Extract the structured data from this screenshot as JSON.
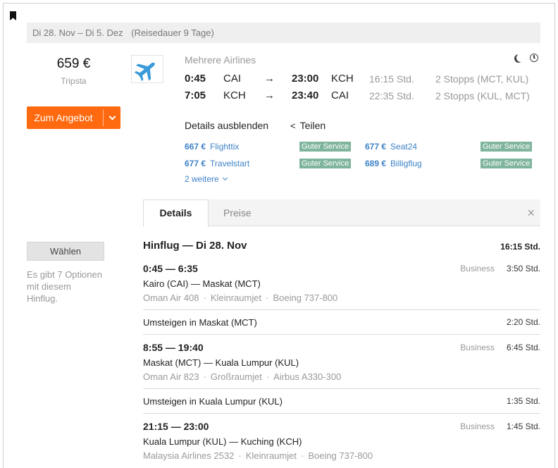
{
  "trip": {
    "dates": "Di 28. Nov – Di 5. Dez",
    "duration": "(Reisedauer 9 Tage)"
  },
  "price": {
    "amount": "659 €",
    "provider": "Tripsta",
    "deal_label": "Zum Angebot"
  },
  "airline": {
    "name": "Mehrere Airlines",
    "logo_icon": "airplane-icon",
    "logo_color": "#3a9ad9"
  },
  "legs": [
    {
      "dep": "0:45",
      "from": "CAI",
      "arrow": "→",
      "arr": "23:00",
      "to": "KCH",
      "duration": "16:15 Std.",
      "stops": "2 Stopps (MCT, KUL)"
    },
    {
      "dep": "7:05",
      "from": "KCH",
      "arrow": "→",
      "arr": "23:40",
      "to": "CAI",
      "duration": "22:35 Std.",
      "stops": "2 Stopps (KUL, MCT)"
    }
  ],
  "actions": {
    "hide_details": "Details ausblenden",
    "share": "Teilen",
    "more": "2 weitere"
  },
  "offers": [
    {
      "price": "667 €",
      "name": "Flighttix",
      "badge": "Guter Service"
    },
    {
      "price": "677 €",
      "name": "Seat24",
      "badge": "Guter Service"
    },
    {
      "price": "677 €",
      "name": "Travelstart",
      "badge": "Guter Service"
    },
    {
      "price": "689 €",
      "name": "Billigflug",
      "badge": "Guter Service"
    }
  ],
  "tabs": {
    "details": "Details",
    "prices": "Preise",
    "close": "×"
  },
  "choose": {
    "button": "Wählen",
    "note": "Es gibt 7 Optionen mit diesem Hinflug."
  },
  "outbound": {
    "title": "Hinflug — Di 28. Nov",
    "total": "16:15 Std.",
    "segments": [
      {
        "times": "0:45 — 6:35",
        "class": "Business",
        "duration": "3:50 Std.",
        "route": "Kairo (CAI) — Maskat (MCT)",
        "flight": "Oman Air 408",
        "aircraft_type": "Kleinraumjet",
        "aircraft": "Boeing 737-800"
      },
      {
        "times": "8:55 — 19:40",
        "class": "Business",
        "duration": "6:45 Std.",
        "route": "Maskat (MCT) — Kuala Lumpur (KUL)",
        "flight": "Oman Air 823",
        "aircraft_type": "Großraumjet",
        "aircraft": "Airbus A330-300"
      },
      {
        "times": "21:15 — 23:00",
        "class": "Business",
        "duration": "1:45 Std.",
        "route": "Kuala Lumpur (KUL) — Kuching (KCH)",
        "flight": "Malaysia Airlines 2532",
        "aircraft_type": "Kleinraumjet",
        "aircraft": "Boeing 737-800"
      }
    ],
    "layovers": [
      {
        "text": "Umsteigen in Maskat (MCT)",
        "duration": "2:20 Std."
      },
      {
        "text": "Umsteigen in Kuala Lumpur (KUL)",
        "duration": "1:35 Std."
      }
    ]
  },
  "colors": {
    "accent": "#ff690f",
    "link": "#3e82c6",
    "badge": "#7fb49d"
  }
}
